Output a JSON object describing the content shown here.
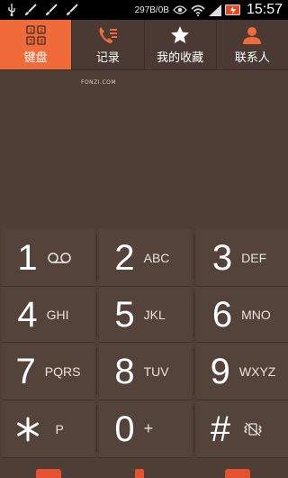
{
  "status_bar": {
    "speed": "297B/0B",
    "time": "15:57",
    "icons": [
      "usb-icon",
      "brush-icon",
      "brush-icon",
      "brush-icon",
      "eye-icon",
      "wifi-icon",
      "signal-icon",
      "battery-charging-icon"
    ]
  },
  "tabs": [
    {
      "label": "键盘",
      "icon": "keypad-icon",
      "active": true
    },
    {
      "label": "记录",
      "icon": "call-log-icon",
      "active": false
    },
    {
      "label": "我的收藏",
      "icon": "star-icon",
      "active": false
    },
    {
      "label": "联系人",
      "icon": "contact-icon",
      "active": false
    }
  ],
  "display": {
    "watermark": "FONZI.COM"
  },
  "keypad": [
    {
      "digit": "1",
      "letters": "",
      "extra_icon": "voicemail-icon"
    },
    {
      "digit": "2",
      "letters": "ABC"
    },
    {
      "digit": "3",
      "letters": "DEF"
    },
    {
      "digit": "4",
      "letters": "GHI"
    },
    {
      "digit": "5",
      "letters": "JKL"
    },
    {
      "digit": "6",
      "letters": "MNO"
    },
    {
      "digit": "7",
      "letters": "PQRS"
    },
    {
      "digit": "8",
      "letters": "TUV"
    },
    {
      "digit": "9",
      "letters": "WXYZ"
    },
    {
      "digit": "*",
      "letters": "P"
    },
    {
      "digit": "0",
      "letters": "+"
    },
    {
      "digit": "#",
      "letters": "",
      "extra_icon": "vibrate-off-icon"
    }
  ],
  "colors": {
    "accent": "#f06a3a",
    "background": "#4f3e36",
    "key": "#54433b",
    "tabbar": "#4a3a33"
  }
}
